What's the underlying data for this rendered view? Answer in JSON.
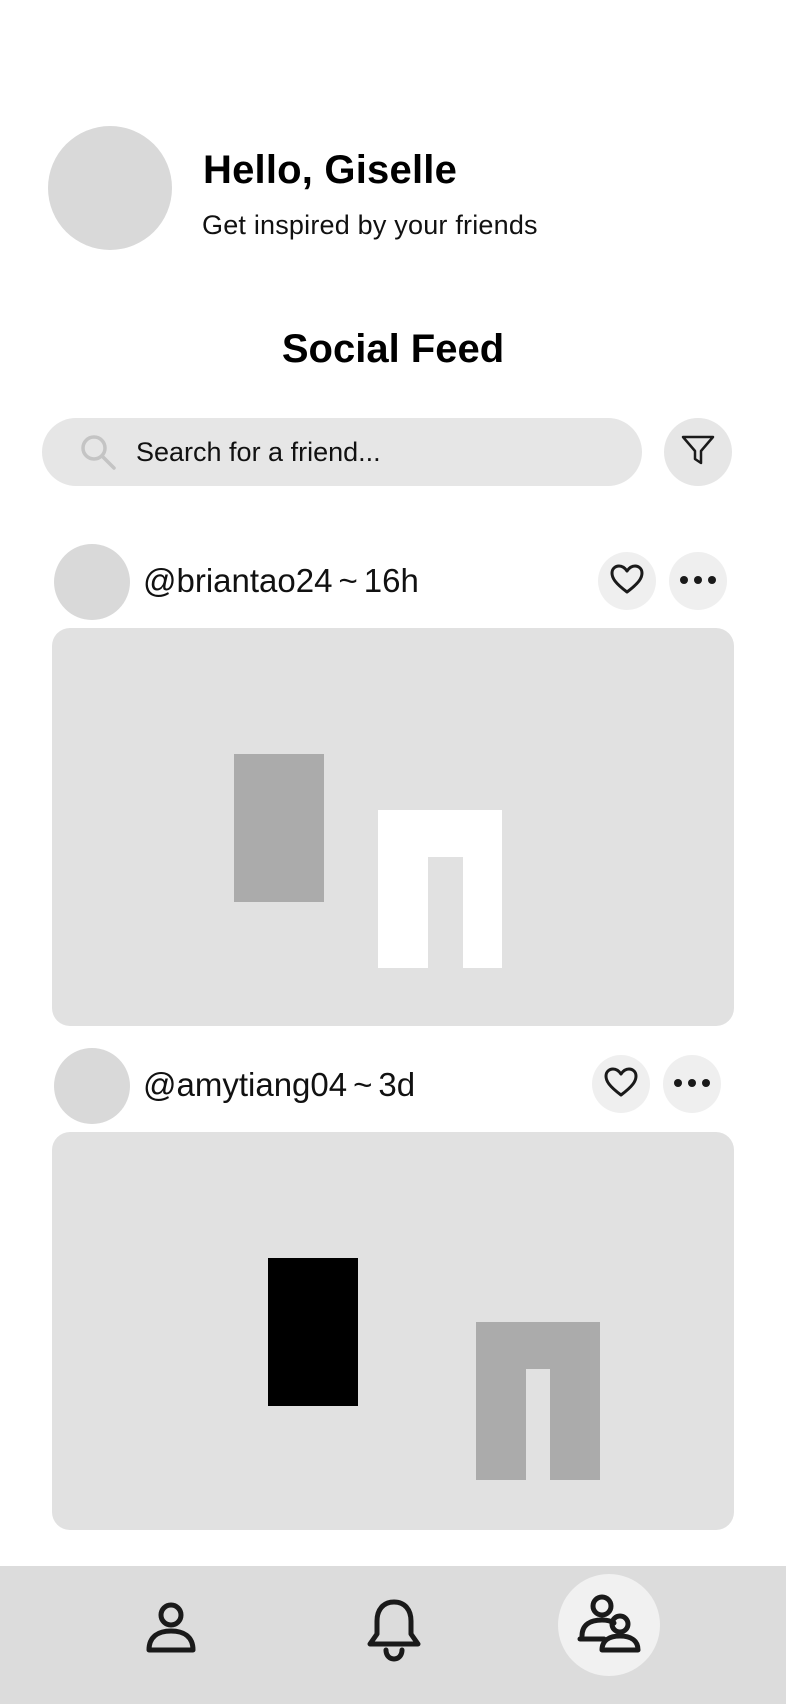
{
  "header": {
    "greeting": "Hello, Giselle",
    "subtitle": "Get inspired by your friends"
  },
  "page": {
    "title": "Social Feed"
  },
  "search": {
    "placeholder": "Search for a friend...",
    "value": "",
    "icon": "search-icon",
    "filter_icon": "filter-icon"
  },
  "posts": [
    {
      "handle": "@briantao24",
      "separator": "~",
      "time": "16h",
      "like_icon": "heart-icon",
      "more_icon": "more-icon"
    },
    {
      "handle": "@amytiang04",
      "separator": "~",
      "time": "3d",
      "like_icon": "heart-icon",
      "more_icon": "more-icon"
    }
  ],
  "bottom_nav": {
    "items": [
      {
        "icon": "profile-icon",
        "active": false
      },
      {
        "icon": "bell-icon",
        "active": false
      },
      {
        "icon": "friends-icon",
        "active": true
      }
    ]
  },
  "colors": {
    "placeholder_gray": "#d9d9d9",
    "image_bg": "#e1e1e1",
    "nav_bg": "#dcdcdc",
    "dark": "#1a1a1a"
  }
}
